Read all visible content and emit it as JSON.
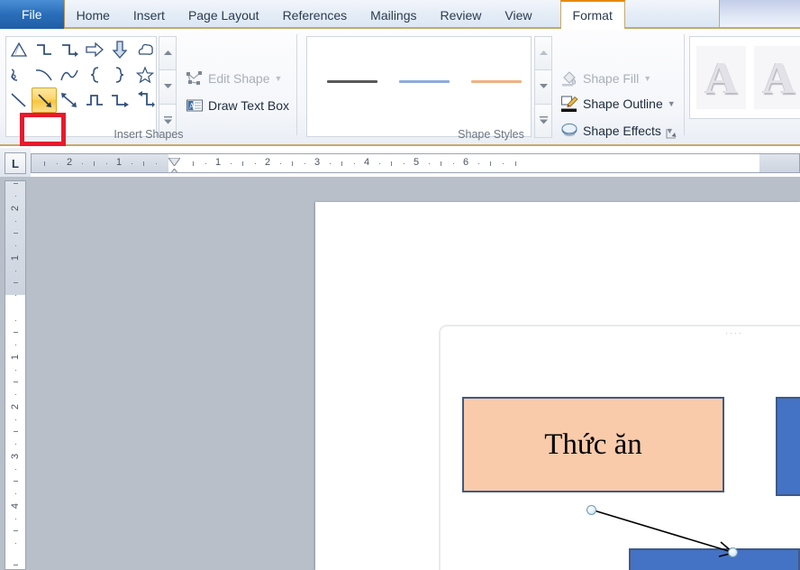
{
  "app": {
    "tabs": [
      {
        "label": "File",
        "state": "file"
      },
      {
        "label": "Home",
        "state": "normal"
      },
      {
        "label": "Insert",
        "state": "normal"
      },
      {
        "label": "Page Layout",
        "state": "normal"
      },
      {
        "label": "References",
        "state": "normal"
      },
      {
        "label": "Mailings",
        "state": "normal"
      },
      {
        "label": "Review",
        "state": "normal"
      },
      {
        "label": "View",
        "state": "normal"
      },
      {
        "label": "Format",
        "state": "active"
      }
    ]
  },
  "ribbon": {
    "groups": [
      {
        "label": "Insert Shapes"
      },
      {
        "label": "Shape Styles"
      }
    ],
    "insert_shapes": {
      "label": "Insert Shapes",
      "selected_shape": "line-arrow",
      "highlight_color": "#e8192c",
      "shapes": [
        "triangle",
        "elbow-connector",
        "elbow-arrow-connector",
        "right-arrow",
        "down-arrow",
        "cloud-shape",
        "scribble",
        "curve",
        "freeform",
        "left-brace",
        "right-brace",
        "star",
        "line",
        "line-arrow",
        "line-double-arrow",
        "elbow-connector-2",
        "elbow-arrow-2",
        "elbow-arrow-3"
      ],
      "scroll_up": "scroll-up",
      "scroll_down": "scroll-down",
      "more": "more-shapes"
    },
    "edit_shape": {
      "label": "Edit Shape",
      "enabled": false
    },
    "draw_text_box": {
      "label": "Draw Text Box",
      "enabled": true
    },
    "shape_styles": {
      "label": "Shape Styles",
      "swatches": [
        "#595959",
        "#8faadc",
        "#f0b183"
      ]
    },
    "shape_fill": {
      "label": "Shape Fill",
      "enabled": false
    },
    "shape_outline": {
      "label": "Shape Outline",
      "enabled": true
    },
    "shape_effects": {
      "label": "Shape Effects",
      "enabled": true
    },
    "wordart": {
      "thumbs": [
        "A",
        "A"
      ]
    }
  },
  "rulers": {
    "tab_selector": "L",
    "horizontal_labels": [
      "2",
      "1",
      "1",
      "2",
      "3",
      "4",
      "5",
      "6"
    ],
    "vertical_labels": [
      "2",
      "1",
      "1",
      "2",
      "3",
      "4"
    ]
  },
  "document": {
    "shapes": [
      {
        "name": "food-box",
        "text": "Thức ăn",
        "fill": "#f9cbab",
        "border": "#3e5a87"
      },
      {
        "name": "blue-box-right",
        "text": "",
        "fill": "#4472c4",
        "border": "#3e5a87"
      },
      {
        "name": "blue-box-bottom",
        "text": "",
        "fill": "#4472c4",
        "border": "#3e5a87"
      }
    ],
    "connector": {
      "name": "arrow-connector",
      "color": "#000000",
      "selected": true
    }
  }
}
